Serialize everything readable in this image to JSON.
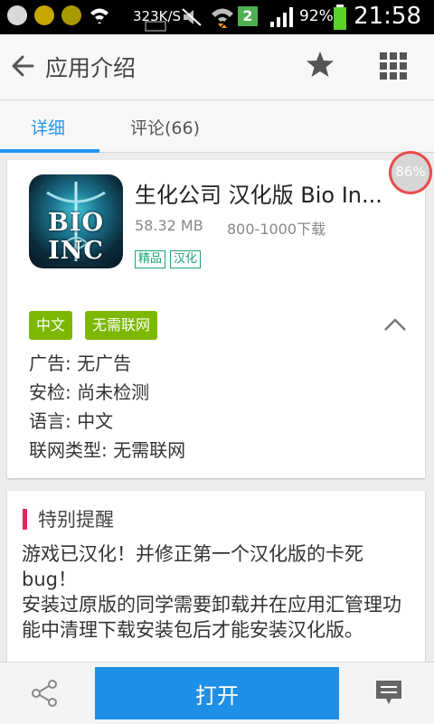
{
  "status_bar": {
    "net_speed": "323K/S",
    "sim_badge": "2",
    "battery": "92%",
    "time": "21:58",
    "icons": [
      "add-notify-icon",
      "app-notify-icon",
      "app-notify-icon",
      "wifi-icon",
      "image-icon",
      "mute-icon",
      "wifi-data-icon",
      "signal-icon",
      "battery-icon"
    ]
  },
  "app_bar": {
    "title": "应用介绍",
    "icons": [
      "back-arrow-icon",
      "star-icon",
      "grid-menu-icon"
    ]
  },
  "tabs": [
    {
      "label": "详细",
      "active": true
    },
    {
      "label": "评论(66)",
      "active": false
    }
  ],
  "app": {
    "name": "生化公司 汉化版  Bio In...",
    "icon_text": "BIO INC",
    "size": "58.32 MB",
    "downloads": "800-1000下载",
    "tags_outline": [
      "精品",
      "汉化"
    ],
    "tags_solid": [
      "中文",
      "无需联网"
    ],
    "info": [
      "广告: 无广告",
      "安检: 尚未检测",
      "语言: 中文",
      "联网类型: 无需联网"
    ]
  },
  "progress_badge": "86%",
  "notice": {
    "title": "特别提醒",
    "lines": [
      "游戏已汉化！并修正第一个汉化版的卡死bug！",
      "安装过原版的同学需要卸载并在应用汇管理功能中清理下载安装包后才能安装汉化版。"
    ]
  },
  "bottom_bar": {
    "open_label": "打开",
    "icons": [
      "share-icon",
      "comment-icon"
    ]
  },
  "colors": {
    "accent": "#1e8fe6",
    "tab_active": "#2196f3",
    "tag_solid": "#7cb800",
    "tag_outline": "#1aa37a",
    "section_marker": "#e4275b"
  }
}
